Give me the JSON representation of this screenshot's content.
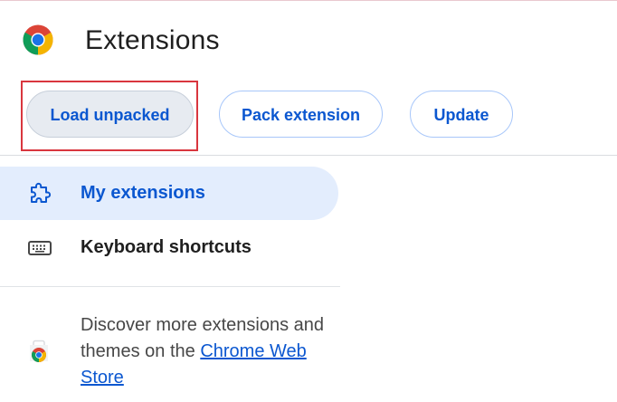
{
  "header": {
    "title": "Extensions",
    "logo_icon": "chrome-logo-icon"
  },
  "toolbar": {
    "load_unpacked_label": "Load unpacked",
    "pack_extension_label": "Pack extension",
    "update_label": "Update",
    "highlight_color": "#d9363e"
  },
  "sidebar": {
    "items": [
      {
        "label": "My extensions",
        "icon": "puzzle-piece-icon",
        "active": true
      },
      {
        "label": "Keyboard shortcuts",
        "icon": "keyboard-icon",
        "active": false
      }
    ],
    "discover": {
      "text": "Discover more extensions and themes on the ",
      "link_text": "Chrome Web Store",
      "icon": "web-store-icon"
    }
  },
  "colors": {
    "accent": "#0b57d0",
    "active_background": "#e3edfd",
    "button_border": "#a8c7fa"
  }
}
